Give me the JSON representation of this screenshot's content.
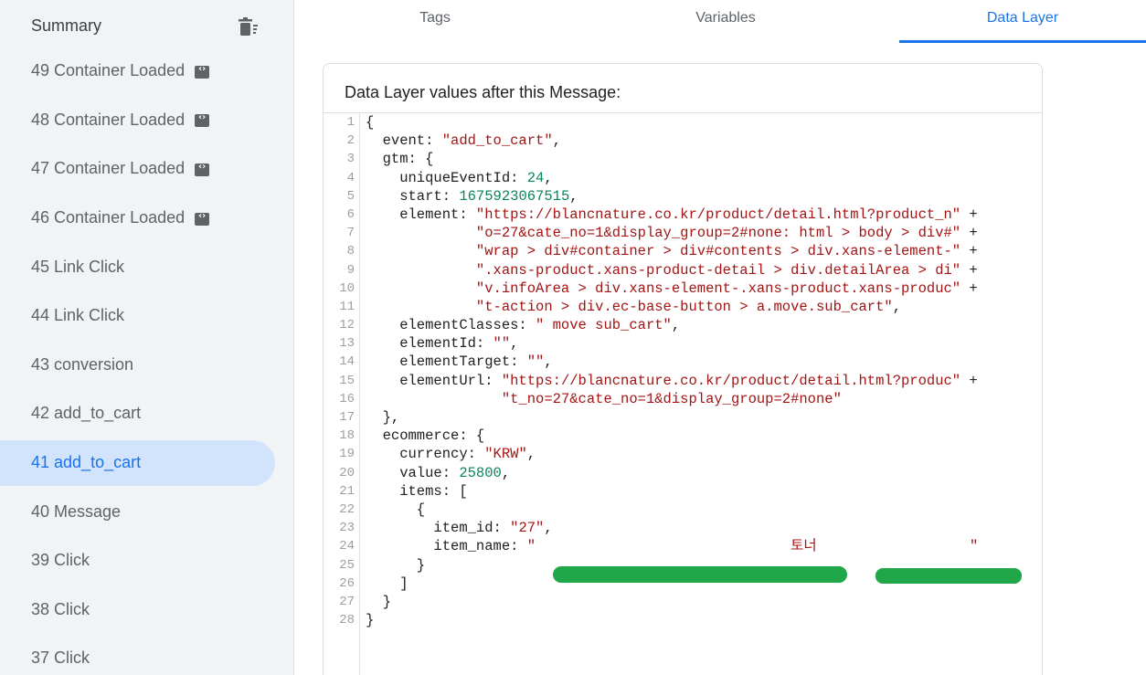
{
  "sidebar": {
    "title": "Summary",
    "trash_icon": "delete-sweep-icon",
    "items": [
      {
        "label": "49 Container Loaded",
        "icon": "code-icon"
      },
      {
        "label": "48 Container Loaded",
        "icon": "code-icon"
      },
      {
        "label": "47 Container Loaded",
        "icon": "code-icon"
      },
      {
        "label": "46 Container Loaded",
        "icon": "code-icon"
      },
      {
        "label": "45 Link Click"
      },
      {
        "label": "44 Link Click"
      },
      {
        "label": "43 conversion"
      },
      {
        "label": "42 add_to_cart"
      },
      {
        "label": "41 add_to_cart",
        "active": true
      },
      {
        "label": "40 Message"
      },
      {
        "label": "39 Click"
      },
      {
        "label": "38 Click"
      },
      {
        "label": "37 Click"
      }
    ]
  },
  "tabs": {
    "tags": "Tags",
    "variables": "Variables",
    "data_layer": "Data Layer",
    "active": "Data Layer"
  },
  "card": {
    "title": "Data Layer values after this Message:"
  },
  "code_lines": [
    "{",
    "  event: \"add_to_cart\",",
    "  gtm: {",
    "    uniqueEventId: 24,",
    "    start: 1675923067515,",
    "    element: \"https://blancnature.co.kr/product/detail.html?product_n\" +",
    "             \"o=27&cate_no=1&display_group=2#none: html > body > div#\" +",
    "             \"wrap > div#container > div#contents > div.xans-element-\" +",
    "             \".xans-product.xans-product-detail > div.detailArea > di\" +",
    "             \"v.infoArea > div.xans-element-.xans-product.xans-produc\" +",
    "             \"t-action > div.ec-base-button > a.move.sub_cart\",",
    "    elementClasses: \" move sub_cart\",",
    "    elementId: \"\",",
    "    elementTarget: \"\",",
    "    elementUrl: \"https://blancnature.co.kr/product/detail.html?produc\" +",
    "                \"t_no=27&cate_no=1&display_group=2#none\"",
    "  },",
    "  ecommerce: {",
    "    currency: \"KRW\",",
    "    value: 25800,",
    "    items: [",
    "      {",
    "        item_id: \"27\",",
    "        item_name: \"                              토너                  \"",
    "      }",
    "    ]",
    "  }",
    "}"
  ],
  "colors": {
    "accent": "#1a73e8",
    "active_bg": "#d2e3fc",
    "string": "#a31515",
    "number": "#098658",
    "redaction": "#1fa74a"
  }
}
